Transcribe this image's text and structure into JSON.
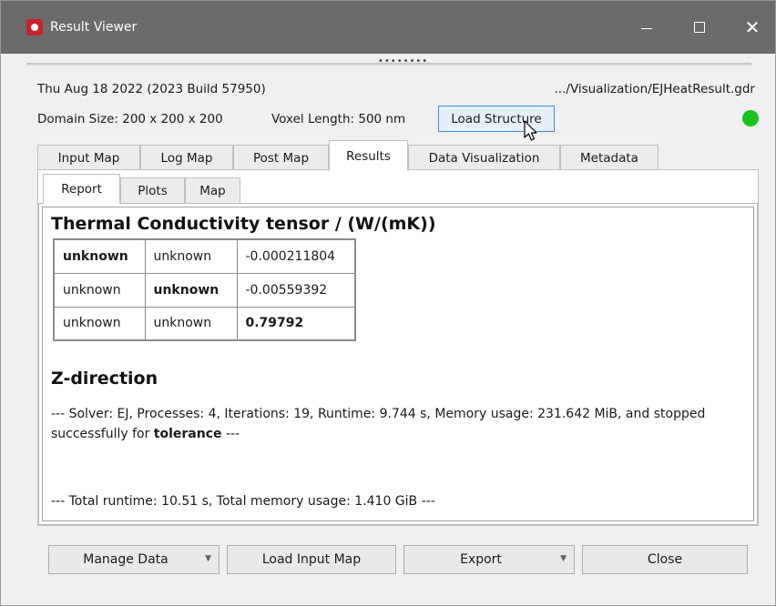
{
  "window": {
    "title": "Result Viewer",
    "close_glyph": "✕"
  },
  "header": {
    "date_line": "Thu Aug 18 2022 (2023 Build 57950)",
    "file_path": ".../Visualization/EJHeatResult.gdr",
    "domain_size": "Domain Size: 200 x 200 x 200",
    "voxel_length": "Voxel Length: 500 nm",
    "load_structure_label": "Load Structure",
    "status_color": "#19c21e"
  },
  "tabs": [
    "Input Map",
    "Log Map",
    "Post Map",
    "Results",
    "Data Visualization",
    "Metadata"
  ],
  "active_tab": "Results",
  "subtabs": [
    "Report",
    "Plots",
    "Map"
  ],
  "active_subtab": "Report",
  "report": {
    "tensor_title": "Thermal Conductivity tensor / (W/(mK))",
    "tensor": [
      [
        "unknown",
        "unknown",
        "-0.000211804"
      ],
      [
        "unknown",
        "unknown",
        "-0.00559392"
      ],
      [
        "unknown",
        "unknown",
        "0.79792"
      ]
    ],
    "direction_title": "Z-direction",
    "solver_line_prefix": "--- Solver: EJ, Processes: 4, Iterations: 19, Runtime: 9.744 s, Memory usage: 231.642 MiB, and stopped successfully for ",
    "solver_line_bold": "tolerance",
    "solver_line_suffix": " ---",
    "total_line": "--- Total runtime: 10.51 s, Total memory usage: 1.410 GiB ---"
  },
  "buttons": {
    "manage_data": "Manage Data",
    "load_input_map": "Load Input Map",
    "export": "Export",
    "close": "Close"
  },
  "icons": {
    "app": "app-logo-icon",
    "cursor": "mouse-pointer-icon",
    "dropdown": "dropdown-arrow-icon"
  }
}
